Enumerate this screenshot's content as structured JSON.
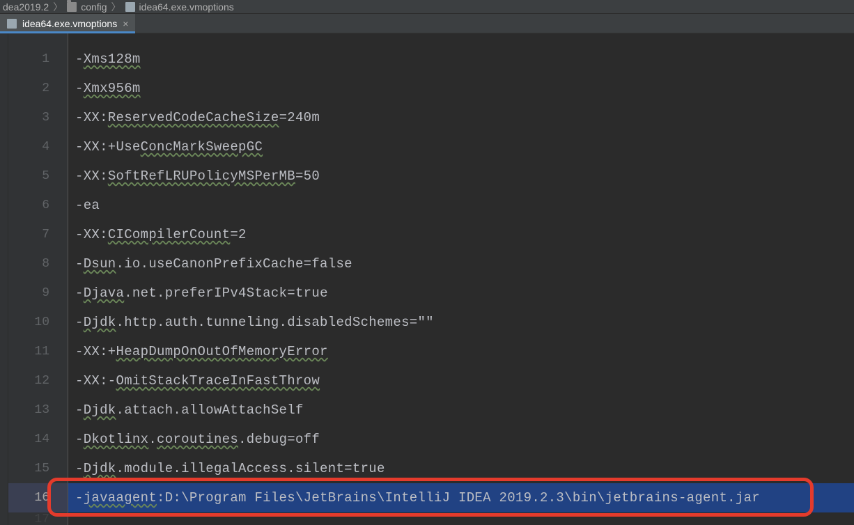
{
  "breadcrumb": {
    "root": "dea2019.2",
    "folder": "config",
    "file": "idea64.exe.vmoptions"
  },
  "tab": {
    "filename": "idea64.exe.vmoptions",
    "close_glyph": "×"
  },
  "lines": [
    {
      "n": "1",
      "pre": "-",
      "u": "Xms128m",
      "post": ""
    },
    {
      "n": "2",
      "pre": "-",
      "u": "Xmx956m",
      "post": ""
    },
    {
      "n": "3",
      "pre": "-XX:",
      "u": "ReservedCodeCacheSize",
      "post": "=240m"
    },
    {
      "n": "4",
      "pre": "-XX:+Use",
      "u": "ConcMarkSweepGC",
      "post": ""
    },
    {
      "n": "5",
      "pre": "-XX:",
      "u": "SoftRefLRUPolicyMSPerMB",
      "post": "=50"
    },
    {
      "n": "6",
      "pre": "-ea",
      "u": "",
      "post": ""
    },
    {
      "n": "7",
      "pre": "-XX:",
      "u": "CICompilerCount",
      "post": "=2"
    },
    {
      "n": "8",
      "pre": "-",
      "u": "Dsun",
      "post": ".io.useCanonPrefixCache=false"
    },
    {
      "n": "9",
      "pre": "-",
      "u": "Djava",
      "post": ".net.preferIPv4Stack=true"
    },
    {
      "n": "10",
      "pre": "-",
      "u": "Djdk",
      "post": ".http.auth.tunneling.disabledSchemes=\"\""
    },
    {
      "n": "11",
      "pre": "-XX:+",
      "u": "HeapDumpOnOutOfMemoryError",
      "post": ""
    },
    {
      "n": "12",
      "pre": "-XX:-",
      "u": "OmitStackTraceInFastThrow",
      "post": ""
    },
    {
      "n": "13",
      "pre": "-",
      "u": "Djdk",
      "post": ".attach.allowAttachSelf"
    },
    {
      "n": "14",
      "pre": "-",
      "u": "Dkotlinx",
      "post": ".coroutines.debug=off",
      "u2": "coroutines"
    },
    {
      "n": "15",
      "pre": "-",
      "u": "Djdk",
      "post": ".module.illegalAccess.silent=true"
    },
    {
      "n": "16",
      "pre": "-",
      "u": "javaagent",
      "post": ":D:\\Program Files\\JetBrains\\IntelliJ IDEA 2019.2.3\\bin\\jetbrains-agent.jar",
      "highlight": true
    }
  ],
  "annotation": {
    "color": "#e43b2c"
  }
}
